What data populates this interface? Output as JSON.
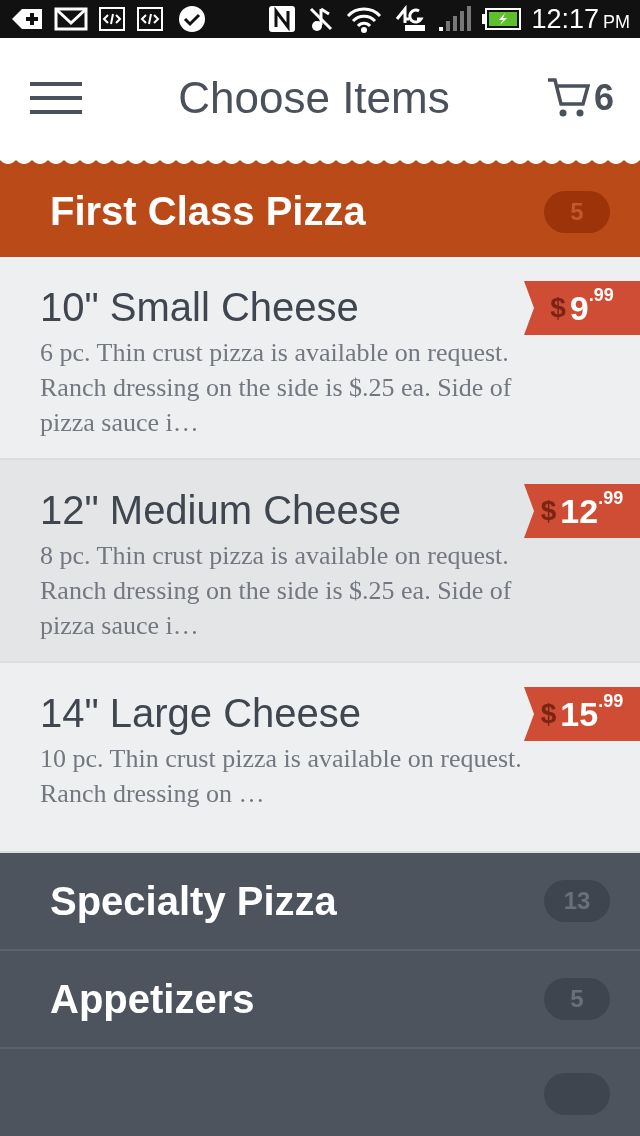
{
  "status_bar": {
    "time": "12:17",
    "meridiem": "PM"
  },
  "header": {
    "title": "Choose Items",
    "cart_count": "6"
  },
  "categories": [
    {
      "name": "First Class Pizza",
      "count": "5",
      "expanded": true,
      "items": [
        {
          "name": "10\" Small Cheese",
          "description": "6 pc. Thin crust pizza is available on request. Ranch dressing on the side is $.25 ea. Side of pizza sauce i…",
          "currency": "$",
          "price": "9$^{.99}$",
          "selected": false
        },
        {
          "name": "12\" Medium Cheese",
          "description": "8 pc. Thin crust pizza is available on request. Ranch dressing on the side is $.25 ea. Side of pizza sauce i…",
          "currency": "$",
          "price": "12$^{.99}$",
          "selected": true
        },
        {
          "name": "14\" Large Cheese",
          "description": "10 pc. Thin crust pizza is available on request. Ranch dressing on …",
          "currency": "$",
          "price": "15$^{.99}$",
          "selected": false
        }
      ]
    },
    {
      "name": "Specialty Pizza",
      "count": "13",
      "expanded": false
    },
    {
      "name": "Appetizers",
      "count": "5",
      "expanded": false
    }
  ]
}
